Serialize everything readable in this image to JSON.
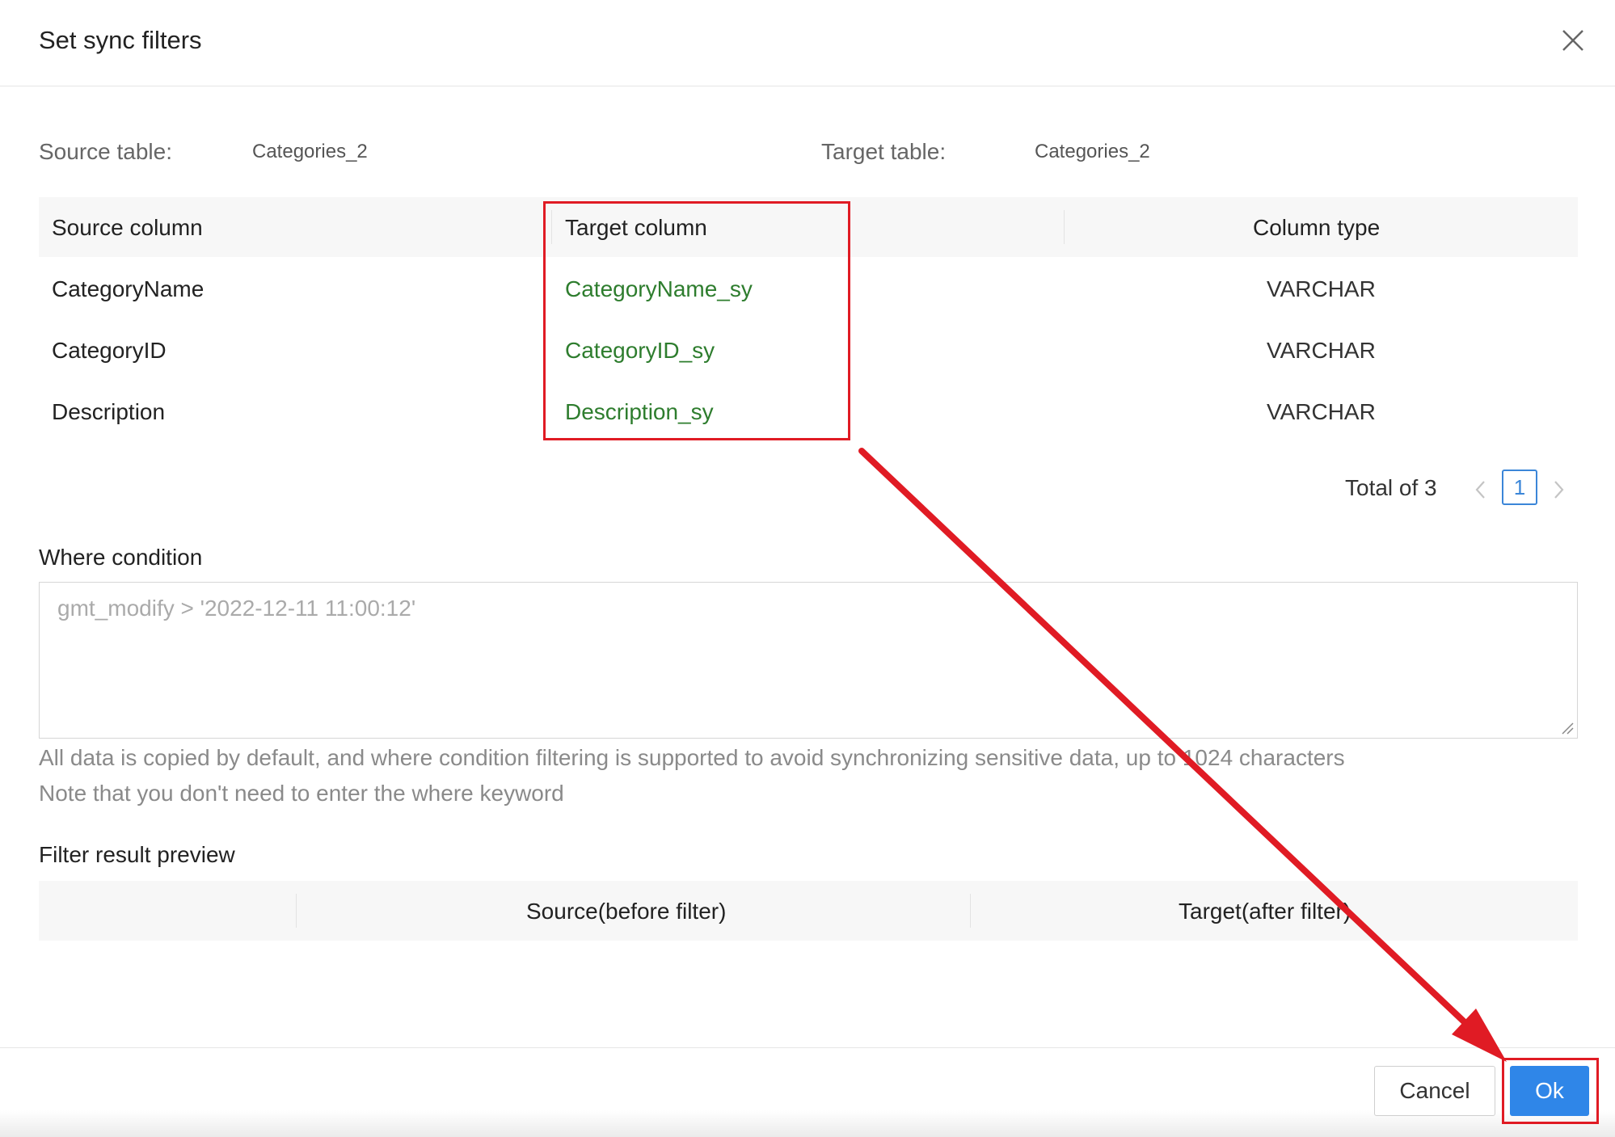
{
  "dialog": {
    "title": "Set sync filters"
  },
  "meta": {
    "source_label": "Source table:",
    "source_value": "Categories_2",
    "target_label": "Target table:",
    "target_value": "Categories_2"
  },
  "columns_table": {
    "headers": {
      "source": "Source column",
      "target": "Target column",
      "type": "Column type"
    },
    "rows": [
      {
        "source": "CategoryName",
        "target": "CategoryName_sy",
        "type": "VARCHAR"
      },
      {
        "source": "CategoryID",
        "target": "CategoryID_sy",
        "type": "VARCHAR"
      },
      {
        "source": "Description",
        "target": "Description_sy",
        "type": "VARCHAR"
      }
    ]
  },
  "pagination": {
    "total_text": "Total of 3",
    "current_page": "1"
  },
  "where": {
    "title": "Where condition",
    "placeholder": "gmt_modify > '2022-12-11 11:00:12'",
    "hint1": "All data is copied by default, and where condition filtering is supported to avoid synchronizing sensitive data, up to 1024 characters",
    "hint2": "Note that you don't need to enter the where keyword"
  },
  "preview": {
    "title": "Filter result preview",
    "headers": {
      "col0": "",
      "source": "Source(before filter)",
      "target": "Target(after filter)"
    }
  },
  "footer": {
    "cancel_label": "Cancel",
    "ok_label": "Ok"
  },
  "colors": {
    "accent": "#2f86e8",
    "target_text": "#2e7d2e",
    "annotation": "#e01b24"
  }
}
